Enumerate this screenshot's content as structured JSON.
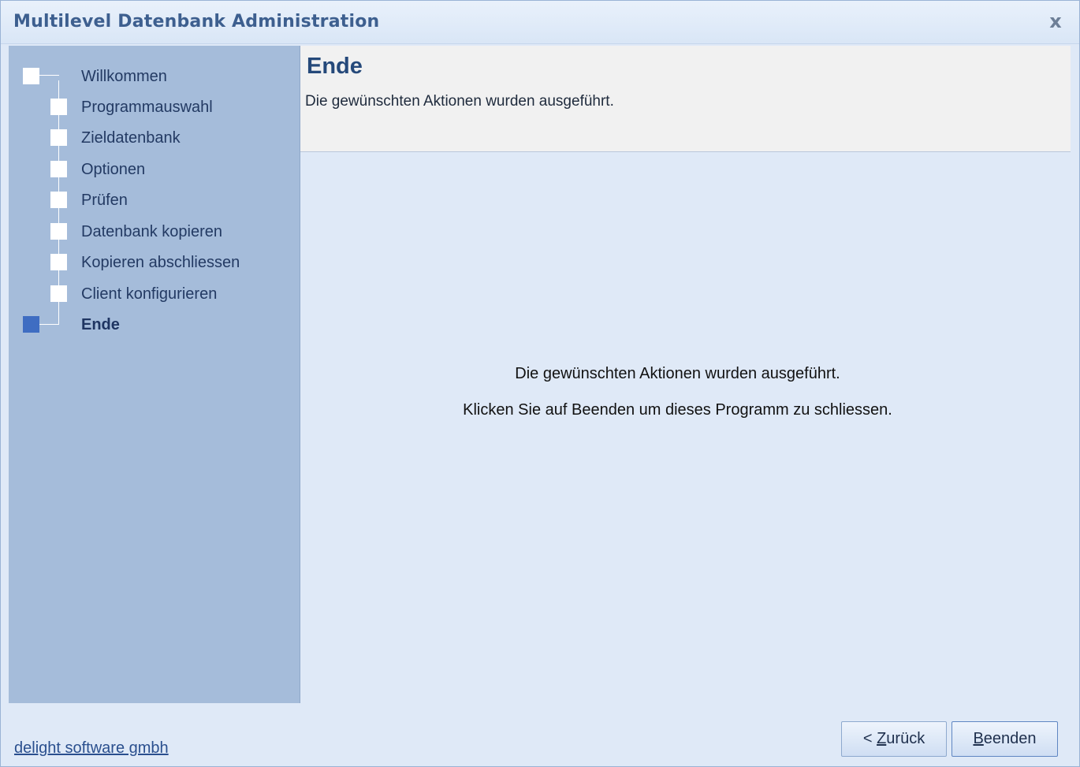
{
  "window": {
    "title": "Multilevel Datenbank Administration",
    "close_glyph": "x"
  },
  "sidebar": {
    "steps": [
      {
        "label": "Willkommen",
        "active": false
      },
      {
        "label": "Programmauswahl",
        "active": false
      },
      {
        "label": "Zieldatenbank",
        "active": false
      },
      {
        "label": "Optionen",
        "active": false
      },
      {
        "label": "Prüfen",
        "active": false
      },
      {
        "label": "Datenbank kopieren",
        "active": false
      },
      {
        "label": "Kopieren abschliessen",
        "active": false
      },
      {
        "label": "Client konfigurieren",
        "active": false
      },
      {
        "label": "Ende",
        "active": true
      }
    ]
  },
  "header": {
    "title": "Ende",
    "subtitle": "Die gewünschten Aktionen wurden ausgeführt."
  },
  "content": {
    "message_1": "Die gewünschten Aktionen wurden ausgeführt.",
    "message_2": "Klicken Sie auf Beenden um dieses Programm zu schliessen."
  },
  "footer": {
    "company_link": "delight software gmbh",
    "back_prefix": "< ",
    "back_mnemonic": "Z",
    "back_rest": "urück",
    "finish_mnemonic": "B",
    "finish_rest": "eenden"
  },
  "colors": {
    "sidebar_bg": "#a5bcda",
    "active_step": "#3f6dc2",
    "title_text": "#3d5f8f"
  }
}
